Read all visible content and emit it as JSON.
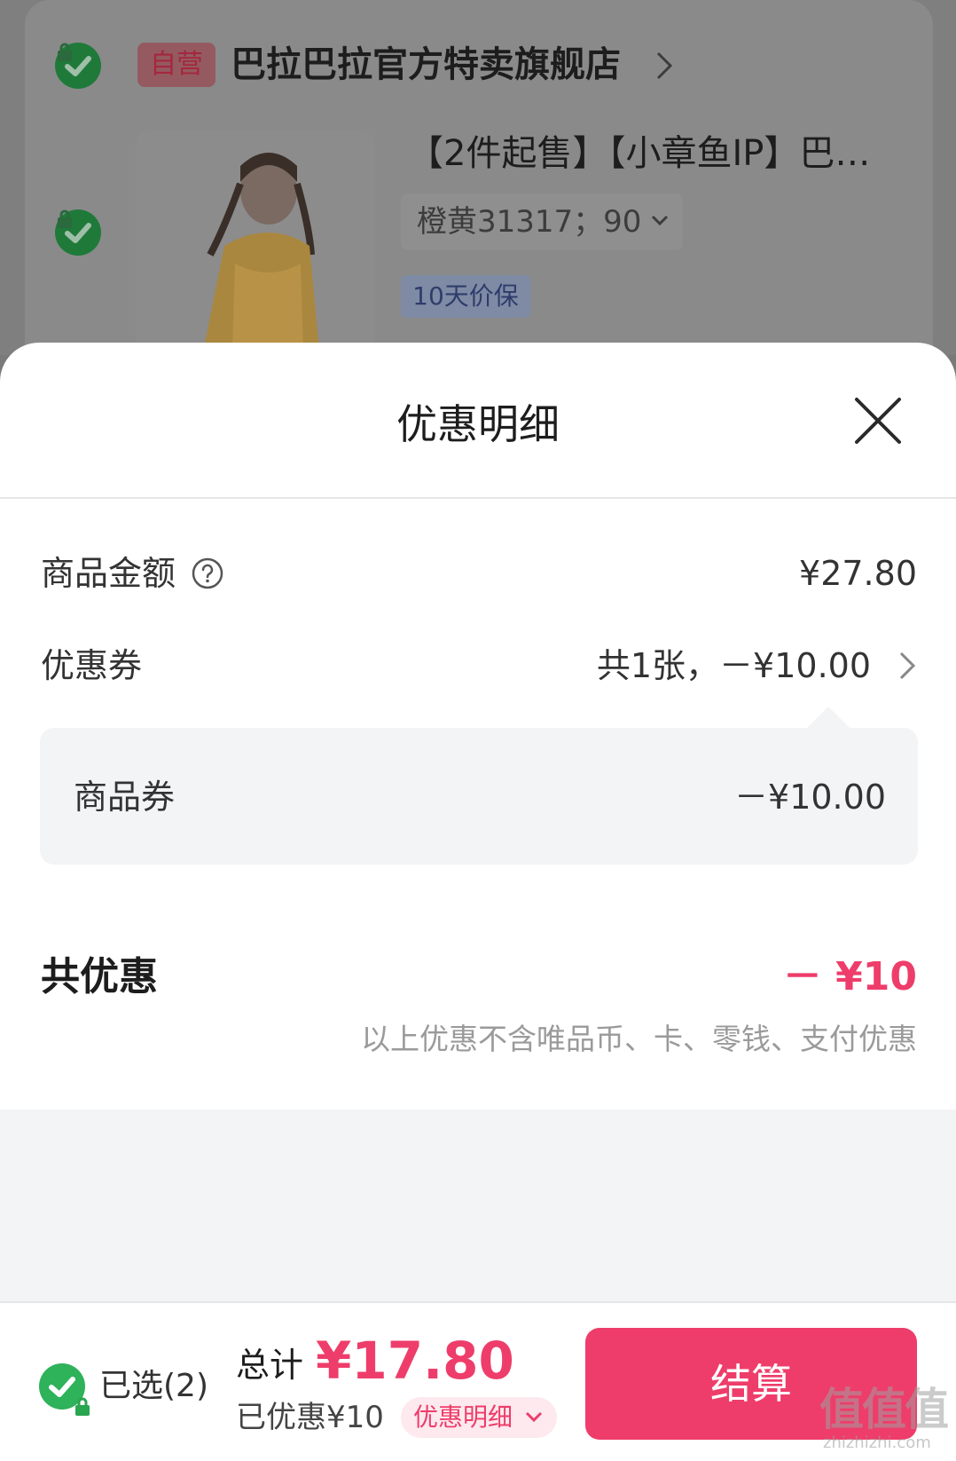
{
  "background_cart": {
    "store_tag": "自营",
    "store_name": "巴拉巴拉官方特卖旗舰店",
    "product_title": "【2件起售】【小章鱼IP】巴…",
    "product_spec": "橙黄31317；90",
    "product_badge": "10天价保"
  },
  "sheet": {
    "title": "优惠明细",
    "rows": {
      "goods_amount": {
        "label": "商品金额",
        "value": "¥27.80"
      },
      "coupon": {
        "label": "优惠券",
        "value": "共1张，－¥10.00"
      },
      "goods_coupon": {
        "label": "商品券",
        "value": "－¥10.00"
      }
    },
    "total": {
      "label": "共优惠",
      "value": "－ ¥10"
    },
    "note": "以上优惠不含唯品币、卡、零钱、支付优惠"
  },
  "bottom_bar": {
    "selected": "已选(2)",
    "total_label": "总计",
    "total_price": "¥17.80",
    "saved": "已优惠¥10",
    "detail_link": "优惠明细",
    "checkout": "结算"
  },
  "watermark": {
    "main": "值值值",
    "sub": "zhizhizhi.com"
  },
  "colors": {
    "accent": "#ee3d6a",
    "check_green": "#2eb25a",
    "sheet_gray": "#f3f4f6"
  }
}
